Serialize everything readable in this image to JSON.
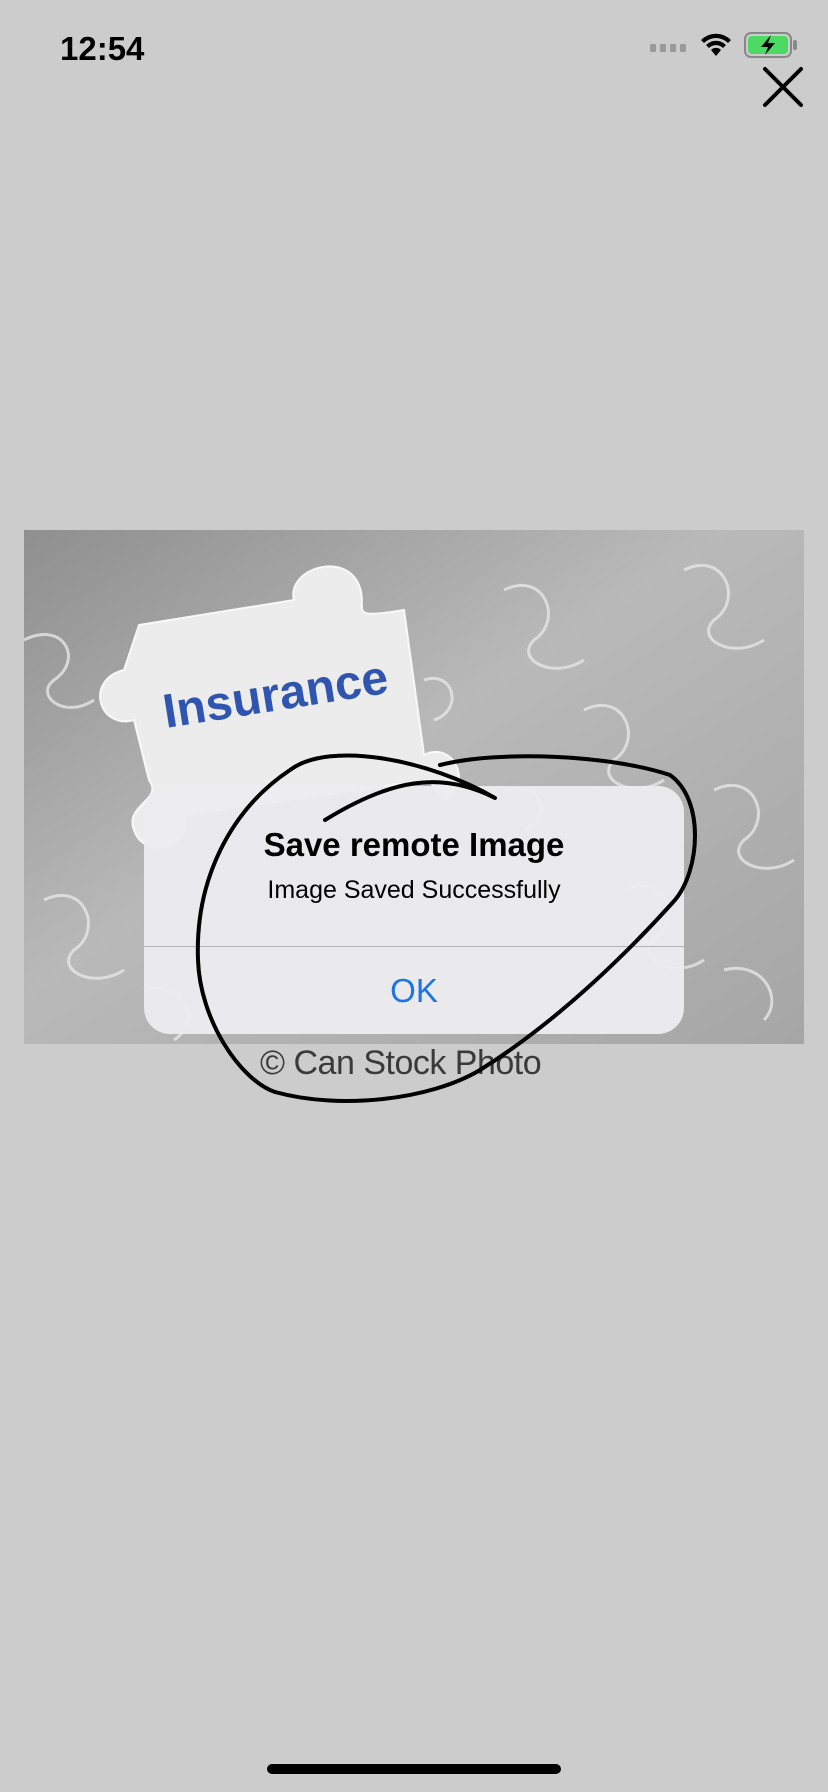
{
  "status_bar": {
    "time": "12:54",
    "icons": [
      "cellular-signal-icon",
      "wifi-icon",
      "battery-charging-icon"
    ]
  },
  "toolbar": {
    "close_icon": "close-icon"
  },
  "image": {
    "puzzle_text": "Insurance",
    "watermark": "© Can Stock Photo"
  },
  "alert": {
    "title": "Save remote Image",
    "message": "Image Saved Successfully",
    "ok_label": "OK",
    "ok_color": "#1a73e8"
  }
}
